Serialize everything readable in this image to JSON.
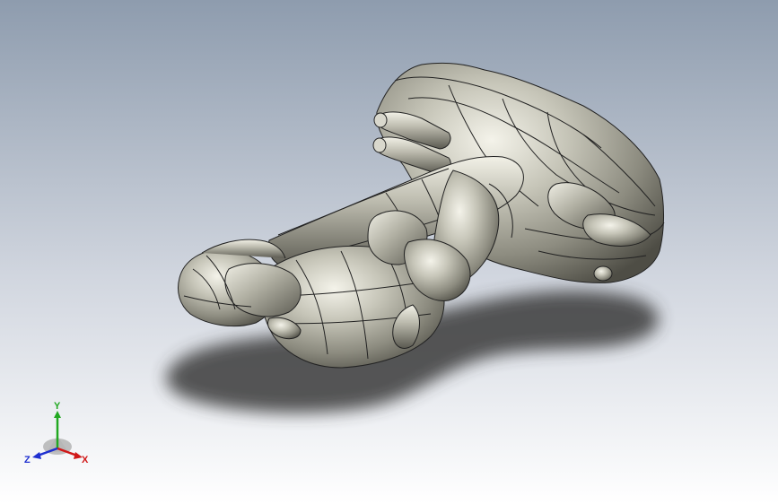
{
  "viewport": {
    "background_top_color": "#8e9cae",
    "background_bottom_color": "#ffffff",
    "model_color": "#b9b8ab"
  },
  "triad": {
    "x_label": "X",
    "y_label": "Y",
    "z_label": "Z",
    "x_color": "#d01818",
    "y_color": "#21a821",
    "z_color": "#1e2fd0"
  }
}
